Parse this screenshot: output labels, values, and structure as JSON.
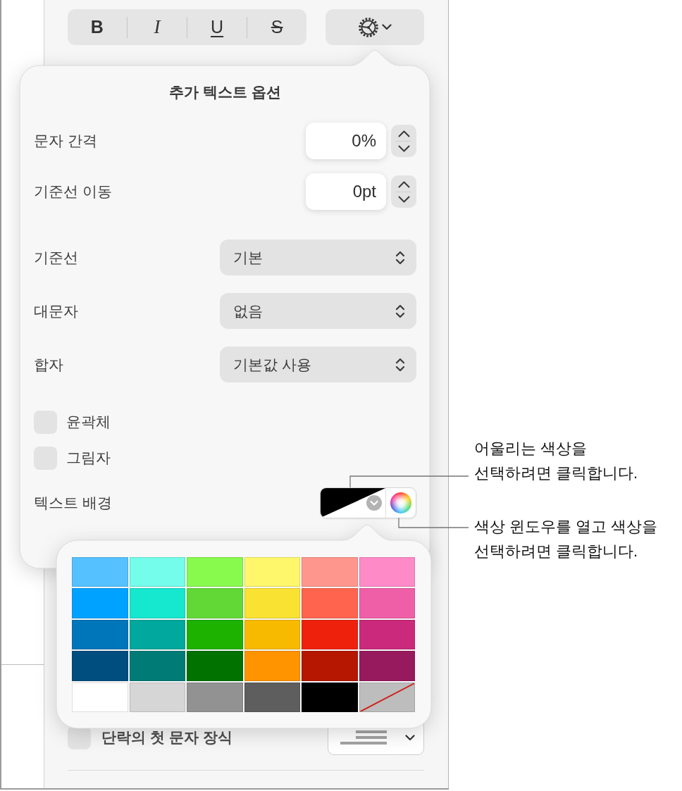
{
  "toolbar": {
    "style_buttons": [
      {
        "label": "B",
        "kind": "bold"
      },
      {
        "label": "I",
        "kind": "italic"
      },
      {
        "label": "U",
        "kind": "underline"
      },
      {
        "label": "S",
        "kind": "strike"
      }
    ]
  },
  "text_options_popover": {
    "title": "추가 텍스트 옵션",
    "rows": [
      {
        "kind": "stepper",
        "label": "문자 간격",
        "value": "0%"
      },
      {
        "kind": "stepper",
        "label": "기준선 이동",
        "value": "0pt"
      },
      {
        "kind": "popup",
        "label": "기준선",
        "value": "기본"
      },
      {
        "kind": "popup",
        "label": "대문자",
        "value": "없음"
      },
      {
        "kind": "popup",
        "label": "합자",
        "value": "기본값 사용"
      },
      {
        "kind": "checkbox",
        "label": "윤곽체",
        "checked": false
      },
      {
        "kind": "checkbox",
        "label": "그림자",
        "checked": false
      },
      {
        "kind": "color",
        "label": "텍스트 배경"
      }
    ]
  },
  "callouts": [
    {
      "lines": [
        "어울리는 색상을",
        "선택하려면 클릭합니다."
      ]
    },
    {
      "lines": [
        "색상 윈도우를 열고 색상을",
        "선택하려면 클릭합니다."
      ]
    }
  ],
  "color_palette": {
    "rows": [
      [
        {
          "kind": "color",
          "color": "#56c1ff"
        },
        {
          "kind": "color",
          "color": "#73fdea"
        },
        {
          "kind": "color",
          "color": "#88fa4e"
        },
        {
          "kind": "color",
          "color": "#fff76b"
        },
        {
          "kind": "color",
          "color": "#ff968d"
        },
        {
          "kind": "color",
          "color": "#ff8ac8"
        }
      ],
      [
        {
          "kind": "color",
          "color": "#00a2ff"
        },
        {
          "kind": "color",
          "color": "#16e7cf"
        },
        {
          "kind": "color",
          "color": "#61d836"
        },
        {
          "kind": "color",
          "color": "#fae232"
        },
        {
          "kind": "color",
          "color": "#ff644e"
        },
        {
          "kind": "color",
          "color": "#ef5fa7"
        }
      ],
      [
        {
          "kind": "color",
          "color": "#0076ba"
        },
        {
          "kind": "color",
          "color": "#00a89d"
        },
        {
          "kind": "color",
          "color": "#1db100"
        },
        {
          "kind": "color",
          "color": "#f8ba00"
        },
        {
          "kind": "color",
          "color": "#ee220c"
        },
        {
          "kind": "color",
          "color": "#cb297b"
        }
      ],
      [
        {
          "kind": "color",
          "color": "#004d7f"
        },
        {
          "kind": "color",
          "color": "#017b76"
        },
        {
          "kind": "color",
          "color": "#017100"
        },
        {
          "kind": "color",
          "color": "#ff9300"
        },
        {
          "kind": "color",
          "color": "#b51700"
        },
        {
          "kind": "color",
          "color": "#981a5e"
        }
      ],
      [
        {
          "kind": "color",
          "color": "#ffffff"
        },
        {
          "kind": "color",
          "color": "#d6d6d6"
        },
        {
          "kind": "color",
          "color": "#929292"
        },
        {
          "kind": "color",
          "color": "#5e5e5e"
        },
        {
          "kind": "color",
          "color": "#000000"
        },
        {
          "kind": "none",
          "color": "#bdbdbd"
        }
      ]
    ]
  },
  "drop_cap": {
    "label": "단락의 첫 문자 장식",
    "checked": false
  }
}
